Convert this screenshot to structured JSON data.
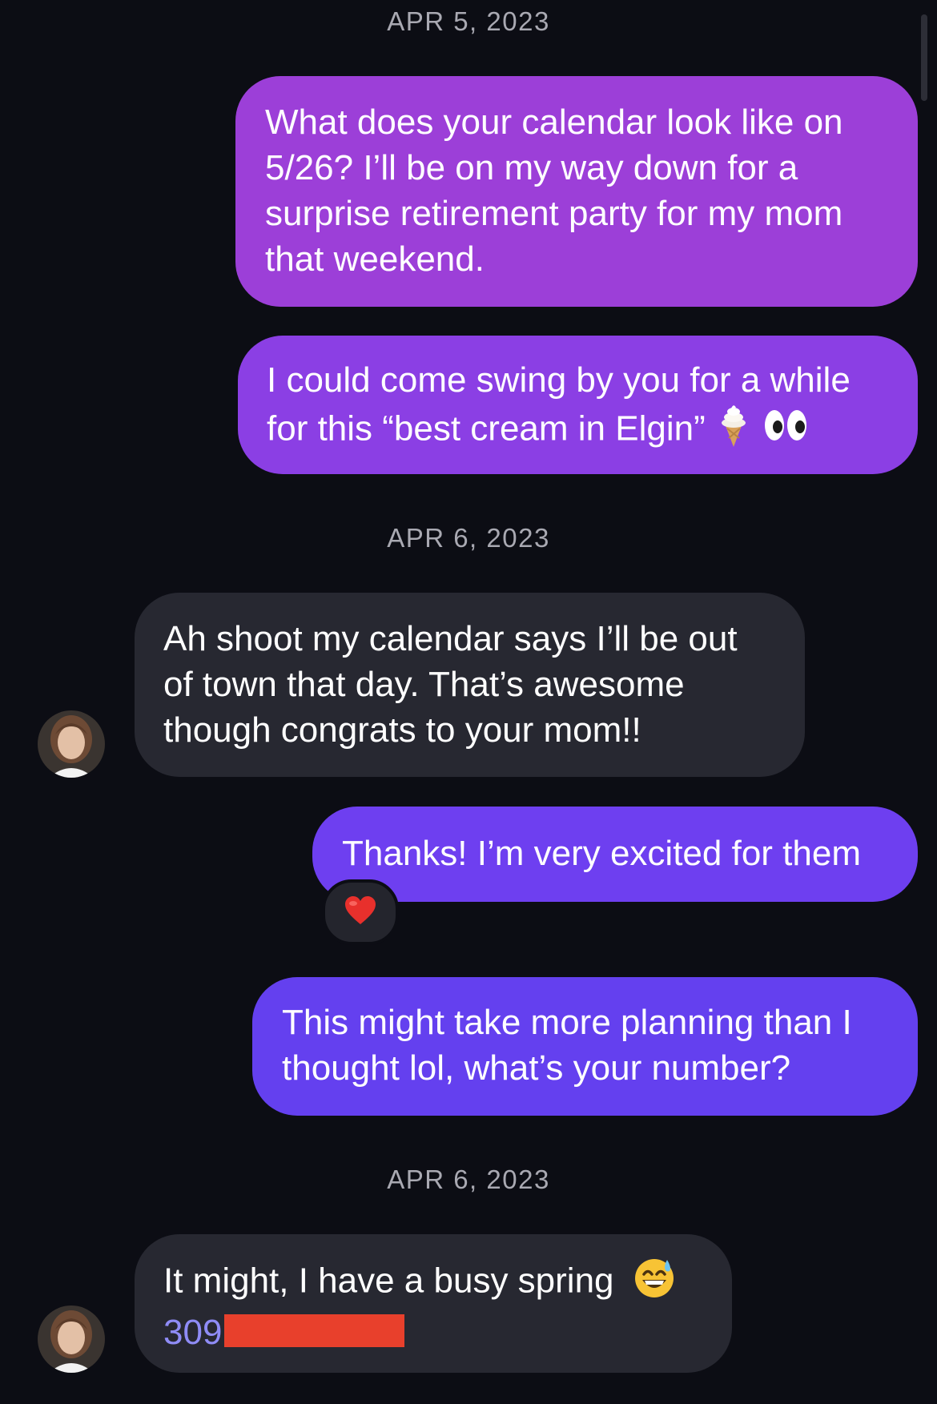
{
  "dates": {
    "first": "APR 5, 2023",
    "second": "APR 6, 2023",
    "third": "APR 6, 2023"
  },
  "messages": [
    {
      "direction": "outgoing",
      "lines": [
        "What does your calendar look like on",
        "5/26? I’ll be on my way down for a",
        "surprise retirement party for my mom",
        "that weekend."
      ]
    },
    {
      "direction": "outgoing",
      "lines": [
        "I could come swing by you for a while",
        "for this “best cream in Elgin”"
      ],
      "emojis": [
        "ice-cream-icon",
        "eyes-icon"
      ]
    },
    {
      "direction": "incoming",
      "lines": [
        "Ah shoot my calendar says I’ll be out",
        "of town that day. That’s awesome",
        "though congrats to your mom!!"
      ]
    },
    {
      "direction": "outgoing",
      "lines": [
        "Thanks! I’m very excited for them"
      ],
      "reaction": "heart-icon"
    },
    {
      "direction": "outgoing",
      "lines": [
        "This might take more planning than I",
        "thought lol, what’s your number?"
      ]
    },
    {
      "direction": "incoming",
      "lines": [
        "It might, I have a busy spring"
      ],
      "emojis": [
        "grinning-sweat-icon"
      ],
      "phone_prefix": "309"
    }
  ],
  "colors": {
    "background": "#0c0d14",
    "outgoing_gradient": [
      "#9b3fd6",
      "#6b3ff2"
    ],
    "incoming_bubble": "#272831",
    "date_text": "#a9a9b2",
    "phone_link": "#8f8cf6",
    "redaction": "#e8402c"
  }
}
